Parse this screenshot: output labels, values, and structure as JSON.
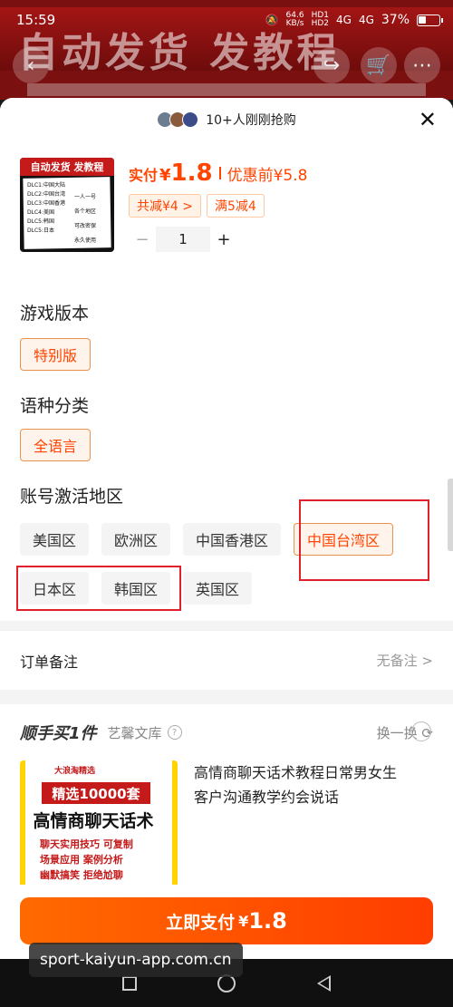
{
  "status_bar": {
    "time": "15:59",
    "net_speed_top": "64.6",
    "net_speed_bottom": "KB/s",
    "hd1": "HD1",
    "hd2": "HD2",
    "signal1": "4G",
    "signal2": "4G",
    "battery": "37%"
  },
  "background": {
    "banner_text": "自动发货 发教程"
  },
  "header": {
    "buyers_text": "10+人刚刚抢购"
  },
  "product": {
    "thumb_title": "自动发货 发教程",
    "thumb_left_lines": [
      "DLC1:中国大陆",
      "DLC2:中国台湾",
      "DLC3:中国香港",
      "DLC4:美国",
      "DLC5:韩国",
      "DLC5:日本"
    ],
    "thumb_right_lines": [
      "一人一号",
      "各个地区",
      "可改密保",
      "永久使用"
    ],
    "price_label": "实付",
    "price_symbol": "¥",
    "price_value": "1.8",
    "orig_price": "优惠前¥5.8",
    "promo1": "共减¥4 >",
    "promo2": "满5减4",
    "qty_minus": "−",
    "qty": "1",
    "qty_plus": "+"
  },
  "sections": {
    "version": {
      "title": "游戏版本",
      "options": [
        "特别版"
      ]
    },
    "language": {
      "title": "语种分类",
      "options": [
        "全语言"
      ]
    },
    "region": {
      "title": "账号激活地区",
      "options": [
        "美国区",
        "欧洲区",
        "中国香港区",
        "中国台湾区",
        "日本区",
        "韩国区",
        "英国区"
      ]
    }
  },
  "remark": {
    "label": "订单备注",
    "value": "无备注 >"
  },
  "shunshou": {
    "title": "顺手买1件",
    "shop": "艺馨文库",
    "help": "?",
    "swap": "换一换 ⟳",
    "img_tag": "大浪淘精选",
    "img_banner": "精选10000套",
    "img_big": "高情商聊天话术",
    "img_lines": [
      "聊天实用技巧 可复制",
      "场景应用 案例分析",
      "幽默搞笑 拒绝尬聊"
    ],
    "desc": "高情商聊天话术教程日常男女生客户沟通教学约会说话"
  },
  "pay": {
    "label": "立即支付",
    "symbol": "¥",
    "value": "1.8"
  },
  "watermark": "sport-kaiyun-app.com.cn",
  "colors": {
    "accent": "#ff4400",
    "annotation_red": "#e0202a",
    "pay_gradient_start": "#ff6a00"
  }
}
